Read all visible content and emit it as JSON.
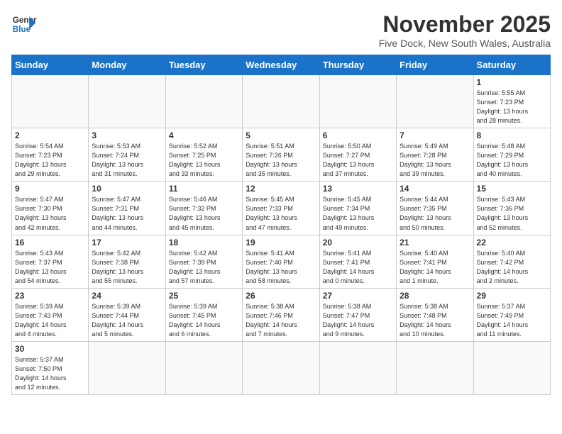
{
  "logo": {
    "line1": "General",
    "line2": "Blue"
  },
  "title": "November 2025",
  "location": "Five Dock, New South Wales, Australia",
  "weekdays": [
    "Sunday",
    "Monday",
    "Tuesday",
    "Wednesday",
    "Thursday",
    "Friday",
    "Saturday"
  ],
  "days": [
    {
      "num": "",
      "info": ""
    },
    {
      "num": "",
      "info": ""
    },
    {
      "num": "",
      "info": ""
    },
    {
      "num": "",
      "info": ""
    },
    {
      "num": "",
      "info": ""
    },
    {
      "num": "",
      "info": ""
    },
    {
      "num": "1",
      "info": "Sunrise: 5:55 AM\nSunset: 7:23 PM\nDaylight: 13 hours\nand 28 minutes."
    },
    {
      "num": "2",
      "info": "Sunrise: 5:54 AM\nSunset: 7:23 PM\nDaylight: 13 hours\nand 29 minutes."
    },
    {
      "num": "3",
      "info": "Sunrise: 5:53 AM\nSunset: 7:24 PM\nDaylight: 13 hours\nand 31 minutes."
    },
    {
      "num": "4",
      "info": "Sunrise: 5:52 AM\nSunset: 7:25 PM\nDaylight: 13 hours\nand 33 minutes."
    },
    {
      "num": "5",
      "info": "Sunrise: 5:51 AM\nSunset: 7:26 PM\nDaylight: 13 hours\nand 35 minutes."
    },
    {
      "num": "6",
      "info": "Sunrise: 5:50 AM\nSunset: 7:27 PM\nDaylight: 13 hours\nand 37 minutes."
    },
    {
      "num": "7",
      "info": "Sunrise: 5:49 AM\nSunset: 7:28 PM\nDaylight: 13 hours\nand 39 minutes."
    },
    {
      "num": "8",
      "info": "Sunrise: 5:48 AM\nSunset: 7:29 PM\nDaylight: 13 hours\nand 40 minutes."
    },
    {
      "num": "9",
      "info": "Sunrise: 5:47 AM\nSunset: 7:30 PM\nDaylight: 13 hours\nand 42 minutes."
    },
    {
      "num": "10",
      "info": "Sunrise: 5:47 AM\nSunset: 7:31 PM\nDaylight: 13 hours\nand 44 minutes."
    },
    {
      "num": "11",
      "info": "Sunrise: 5:46 AM\nSunset: 7:32 PM\nDaylight: 13 hours\nand 45 minutes."
    },
    {
      "num": "12",
      "info": "Sunrise: 5:45 AM\nSunset: 7:33 PM\nDaylight: 13 hours\nand 47 minutes."
    },
    {
      "num": "13",
      "info": "Sunrise: 5:45 AM\nSunset: 7:34 PM\nDaylight: 13 hours\nand 49 minutes."
    },
    {
      "num": "14",
      "info": "Sunrise: 5:44 AM\nSunset: 7:35 PM\nDaylight: 13 hours\nand 50 minutes."
    },
    {
      "num": "15",
      "info": "Sunrise: 5:43 AM\nSunset: 7:36 PM\nDaylight: 13 hours\nand 52 minutes."
    },
    {
      "num": "16",
      "info": "Sunrise: 5:43 AM\nSunset: 7:37 PM\nDaylight: 13 hours\nand 54 minutes."
    },
    {
      "num": "17",
      "info": "Sunrise: 5:42 AM\nSunset: 7:38 PM\nDaylight: 13 hours\nand 55 minutes."
    },
    {
      "num": "18",
      "info": "Sunrise: 5:42 AM\nSunset: 7:39 PM\nDaylight: 13 hours\nand 57 minutes."
    },
    {
      "num": "19",
      "info": "Sunrise: 5:41 AM\nSunset: 7:40 PM\nDaylight: 13 hours\nand 58 minutes."
    },
    {
      "num": "20",
      "info": "Sunrise: 5:41 AM\nSunset: 7:41 PM\nDaylight: 14 hours\nand 0 minutes."
    },
    {
      "num": "21",
      "info": "Sunrise: 5:40 AM\nSunset: 7:41 PM\nDaylight: 14 hours\nand 1 minute."
    },
    {
      "num": "22",
      "info": "Sunrise: 5:40 AM\nSunset: 7:42 PM\nDaylight: 14 hours\nand 2 minutes."
    },
    {
      "num": "23",
      "info": "Sunrise: 5:39 AM\nSunset: 7:43 PM\nDaylight: 14 hours\nand 4 minutes."
    },
    {
      "num": "24",
      "info": "Sunrise: 5:39 AM\nSunset: 7:44 PM\nDaylight: 14 hours\nand 5 minutes."
    },
    {
      "num": "25",
      "info": "Sunrise: 5:39 AM\nSunset: 7:45 PM\nDaylight: 14 hours\nand 6 minutes."
    },
    {
      "num": "26",
      "info": "Sunrise: 5:38 AM\nSunset: 7:46 PM\nDaylight: 14 hours\nand 7 minutes."
    },
    {
      "num": "27",
      "info": "Sunrise: 5:38 AM\nSunset: 7:47 PM\nDaylight: 14 hours\nand 9 minutes."
    },
    {
      "num": "28",
      "info": "Sunrise: 5:38 AM\nSunset: 7:48 PM\nDaylight: 14 hours\nand 10 minutes."
    },
    {
      "num": "29",
      "info": "Sunrise: 5:37 AM\nSunset: 7:49 PM\nDaylight: 14 hours\nand 11 minutes."
    },
    {
      "num": "30",
      "info": "Sunrise: 5:37 AM\nSunset: 7:50 PM\nDaylight: 14 hours\nand 12 minutes."
    }
  ]
}
